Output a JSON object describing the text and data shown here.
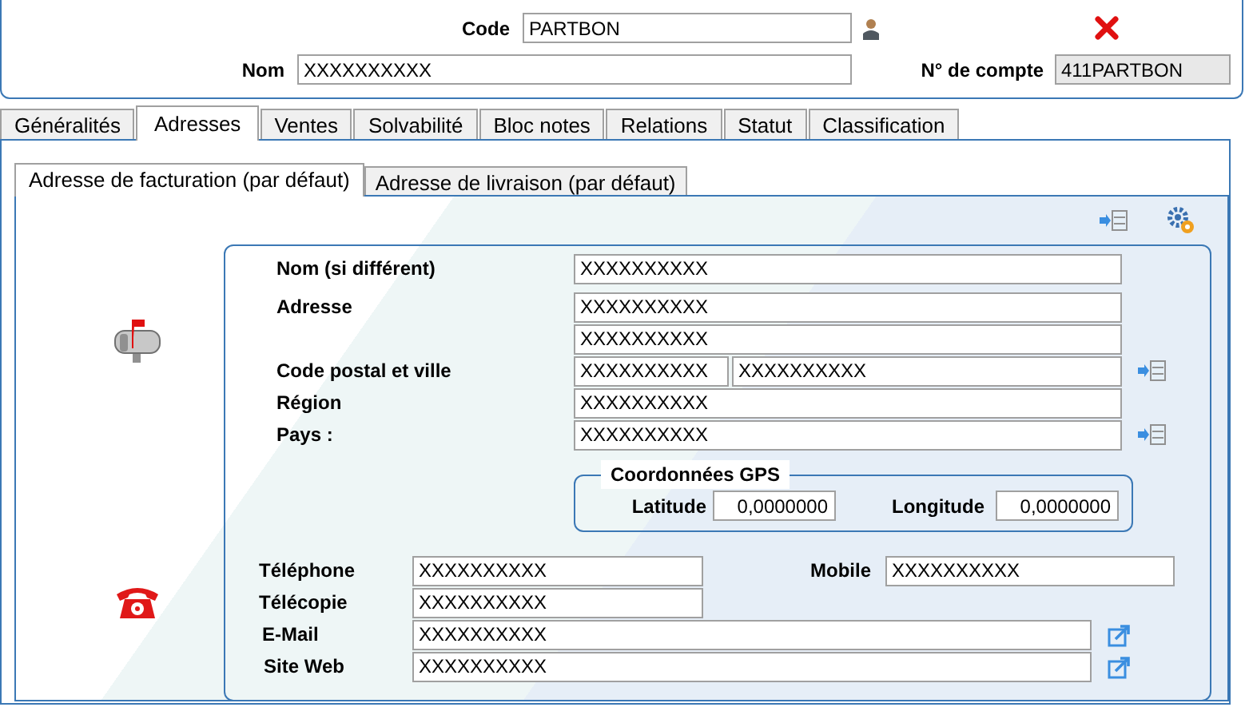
{
  "header": {
    "code_label": "Code",
    "code": "PARTBON",
    "name_label": "Nom",
    "name": "XXXXXXXXXX",
    "account_label": "N° de compte",
    "account": "411PARTBON"
  },
  "tabs": [
    {
      "label": "Généralités",
      "selected": false
    },
    {
      "label": "Adresses",
      "selected": true
    },
    {
      "label": "Ventes",
      "selected": false
    },
    {
      "label": "Solvabilité",
      "selected": false
    },
    {
      "label": "Bloc notes",
      "selected": false
    },
    {
      "label": "Relations",
      "selected": false
    },
    {
      "label": "Statut",
      "selected": false
    },
    {
      "label": "Classification",
      "selected": false
    }
  ],
  "address_tabs": [
    {
      "label": "Adresse de facturation (par défaut)",
      "selected": true
    },
    {
      "label": "Adresse de livraison (par défaut)",
      "selected": false
    }
  ],
  "address_fields": [
    {
      "label": "Nom (si différent)",
      "values": [
        "XXXXXXXXXX"
      ],
      "lookup": false
    },
    {
      "label": "Adresse",
      "values": [
        "XXXXXXXXXX"
      ],
      "lookup": false
    },
    {
      "values": [
        "XXXXXXXXXX"
      ],
      "lookup": false
    },
    {
      "label": "Code postal et ville",
      "values": [
        "XXXXXXXXXX",
        "XXXXXXXXXX"
      ],
      "lookup": true
    },
    {
      "label": "Région",
      "values": [
        "XXXXXXXXXX"
      ],
      "lookup": false
    },
    {
      "label": "Pays :",
      "values": [
        "XXXXXXXXXX"
      ],
      "lookup": true
    }
  ],
  "gps": {
    "title": "Coordonnées GPS",
    "latitude_label": "Latitude",
    "latitude": "0,0000000",
    "longitude_label": "Longitude",
    "longitude": "0,0000000"
  },
  "contacts": {
    "phone_label": "Téléphone",
    "phone": "XXXXXXXXXX",
    "mobile_label": "Mobile",
    "mobile": "XXXXXXXXXX",
    "fax_label": "Télécopie",
    "fax": "XXXXXXXXXX",
    "email_label": "E-Mail",
    "email": "XXXXXXXXXX",
    "web_label": "Site Web",
    "web": "XXXXXXXXXX"
  }
}
